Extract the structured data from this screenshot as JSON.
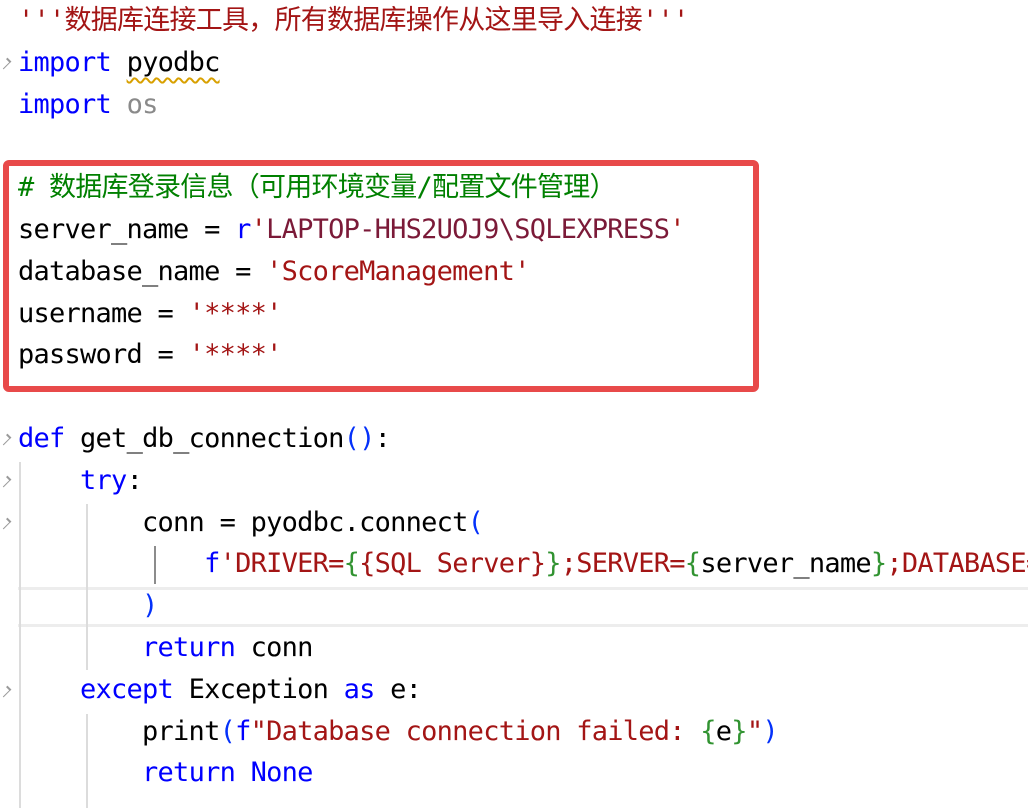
{
  "editor": {
    "language": "python",
    "colors": {
      "keyword": "#0000ff",
      "string": "#a31515",
      "comment": "#008000",
      "annotation_box": "#e84a4a"
    },
    "lines": [
      [
        {
          "t": "'''数据库连接工具，所有数据库操作从这里导入连接'''",
          "c": "docstring"
        }
      ],
      [
        {
          "t": "import",
          "c": "keyword"
        },
        {
          "t": " ",
          "c": "default"
        },
        {
          "t": "pyodbc",
          "c": "module",
          "s": true
        }
      ],
      [
        {
          "t": "import",
          "c": "keyword"
        },
        {
          "t": " ",
          "c": "default"
        },
        {
          "t": "os",
          "c": "unused"
        }
      ],
      [],
      [
        {
          "t": "# 数据库登录信息（可用环境变量/配置文件管理）",
          "c": "comment"
        }
      ],
      [
        {
          "t": "server_name = ",
          "c": "default"
        },
        {
          "t": "r",
          "c": "prefix"
        },
        {
          "t": "'",
          "c": "string"
        },
        {
          "t": "LAPTOP-HHS2UOJ9\\SQLEXPRESS",
          "c": "str-inner"
        },
        {
          "t": "'",
          "c": "string"
        }
      ],
      [
        {
          "t": "database_name = ",
          "c": "default"
        },
        {
          "t": "'ScoreManagement'",
          "c": "string"
        }
      ],
      [
        {
          "t": "username = ",
          "c": "default"
        },
        {
          "t": "'****'",
          "c": "string"
        }
      ],
      [
        {
          "t": "password = ",
          "c": "default"
        },
        {
          "t": "'****'",
          "c": "string"
        }
      ],
      [],
      [
        {
          "t": "def",
          "c": "keyword"
        },
        {
          "t": " ",
          "c": "default"
        },
        {
          "t": "get_db_connection",
          "c": "fname"
        },
        {
          "t": "()",
          "c": "paren1"
        },
        {
          "t": ":",
          "c": "default"
        }
      ],
      [
        {
          "t": "    ",
          "c": "default"
        },
        {
          "t": "try",
          "c": "control"
        },
        {
          "t": ":",
          "c": "default"
        }
      ],
      [
        {
          "t": "        conn = pyodbc.connect",
          "c": "default"
        },
        {
          "t": "(",
          "c": "paren1"
        }
      ],
      [
        {
          "t": "            ",
          "c": "default"
        },
        {
          "t": "f",
          "c": "prefix"
        },
        {
          "t": "'DRIVER=",
          "c": "string"
        },
        {
          "t": "{",
          "c": "paren2"
        },
        {
          "t": "{SQL Server}",
          "c": "string"
        },
        {
          "t": "}",
          "c": "paren2"
        },
        {
          "t": ";SERVER=",
          "c": "string"
        },
        {
          "t": "{",
          "c": "paren2"
        },
        {
          "t": "server_name",
          "c": "default"
        },
        {
          "t": "}",
          "c": "paren2"
        },
        {
          "t": ";DATABASE=",
          "c": "string"
        }
      ],
      [
        {
          "t": "        ",
          "c": "default"
        },
        {
          "t": ")",
          "c": "paren1"
        }
      ],
      [
        {
          "t": "        ",
          "c": "default"
        },
        {
          "t": "return",
          "c": "control"
        },
        {
          "t": " conn",
          "c": "default"
        }
      ],
      [
        {
          "t": "    ",
          "c": "default"
        },
        {
          "t": "except",
          "c": "control"
        },
        {
          "t": " Exception ",
          "c": "default"
        },
        {
          "t": "as",
          "c": "control"
        },
        {
          "t": " e:",
          "c": "default"
        }
      ],
      [
        {
          "t": "        print",
          "c": "default"
        },
        {
          "t": "(",
          "c": "paren1"
        },
        {
          "t": "f",
          "c": "prefix"
        },
        {
          "t": "\"Database connection failed: ",
          "c": "string"
        },
        {
          "t": "{",
          "c": "paren2"
        },
        {
          "t": "e",
          "c": "default"
        },
        {
          "t": "}",
          "c": "paren2"
        },
        {
          "t": "\"",
          "c": "string"
        },
        {
          "t": ")",
          "c": "paren1"
        }
      ],
      [
        {
          "t": "        ",
          "c": "default"
        },
        {
          "t": "return",
          "c": "control"
        },
        {
          "t": " ",
          "c": "default"
        },
        {
          "t": "None",
          "c": "keyword"
        }
      ]
    ]
  }
}
